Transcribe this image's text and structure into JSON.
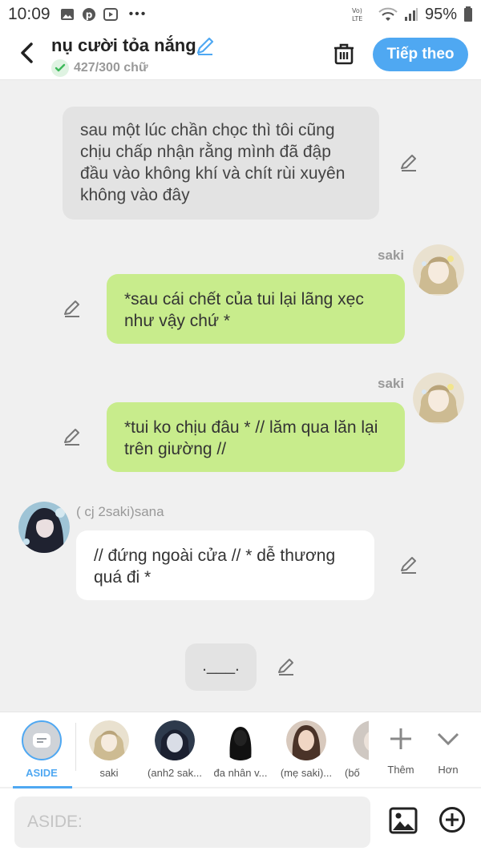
{
  "status_bar": {
    "time": "10:09",
    "dots": "•••",
    "network": "VoLTE",
    "battery": "95%"
  },
  "header": {
    "title": "nụ cười tỏa nắng",
    "word_count": "427/300 chữ",
    "next_label": "Tiếp theo",
    "accent_color": "#4fa8f2"
  },
  "messages": [
    {
      "type": "narration",
      "text": "sau một lúc chần chọc thì tôi cũng chịu chấp nhận rằng mình đã đập đầu vào không khí và chít rùi xuyên không vào đây"
    },
    {
      "type": "right",
      "speaker": "saki",
      "text": "*sau cái chết của tui lại lãng xẹc như vậy chứ *"
    },
    {
      "type": "right",
      "speaker": "saki",
      "text": "*tui ko chịu đâu * // lăm qua lăn lại trên giường //"
    },
    {
      "type": "left",
      "speaker": "( cj 2saki)sana",
      "text": "// đứng ngoài cửa // * dễ thương quá đi *"
    },
    {
      "type": "narration",
      "text": ".___."
    }
  ],
  "characters": [
    {
      "label": "ASIDE",
      "selected": true
    },
    {
      "label": "saki"
    },
    {
      "label": "(anh2 sak..."
    },
    {
      "label": "đa nhân v..."
    },
    {
      "label": "(mẹ saki)..."
    },
    {
      "label": "(bố"
    }
  ],
  "char_actions": {
    "add_label": "Thêm",
    "more_label": "Hơn"
  },
  "input": {
    "placeholder": "ASIDE:"
  }
}
